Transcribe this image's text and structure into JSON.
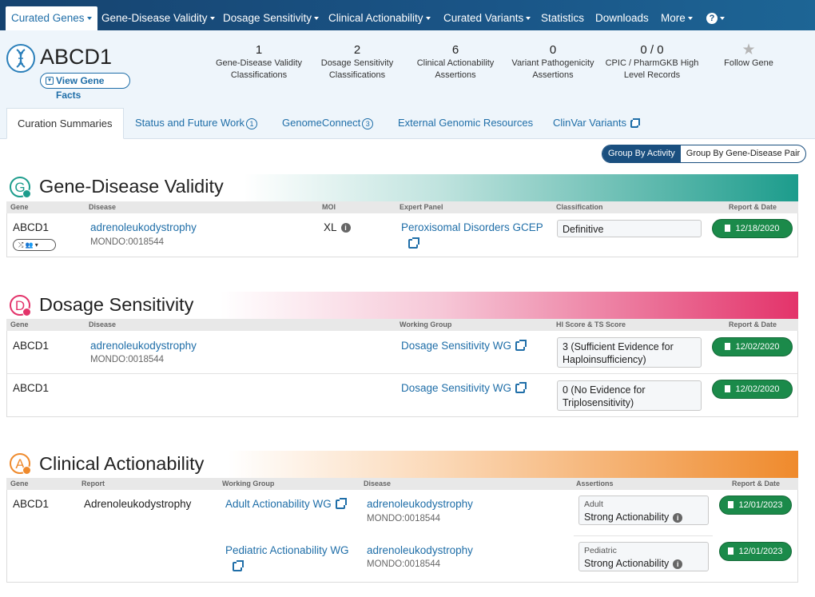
{
  "nav": {
    "items": [
      {
        "label": "Curated Genes",
        "dropdown": true
      },
      {
        "label": "Gene-Disease Validity",
        "dropdown": true
      },
      {
        "label": "Dosage Sensitivity",
        "dropdown": true
      },
      {
        "label": "Clinical Actionability",
        "dropdown": true
      },
      {
        "label": "Curated Variants",
        "dropdown": true
      },
      {
        "label": "Statistics",
        "dropdown": false
      },
      {
        "label": "Downloads",
        "dropdown": false
      },
      {
        "label": "More",
        "dropdown": true
      },
      {
        "label": "?",
        "dropdown": true
      }
    ]
  },
  "gene": {
    "symbol": "ABCD1",
    "facts_label": "View Gene Facts"
  },
  "stats": [
    {
      "value": "1",
      "label": "Gene-Disease Validity Classifications"
    },
    {
      "value": "2",
      "label": "Dosage Sensitivity Classifications"
    },
    {
      "value": "6",
      "label": "Clinical Actionability Assertions"
    },
    {
      "value": "0",
      "label": "Variant Pathogenicity Assertions"
    },
    {
      "value": "0 / 0",
      "label": "CPIC / PharmGKB High Level Records"
    },
    {
      "value": "★",
      "label": "Follow Gene"
    }
  ],
  "tabs": [
    {
      "label": "Curation Summaries",
      "count": ""
    },
    {
      "label": "Status and Future Work",
      "count": "1"
    },
    {
      "label": "GenomeConnect",
      "count": "3"
    },
    {
      "label": "External Genomic Resources",
      "count": ""
    },
    {
      "label": "ClinVar Variants",
      "count": ""
    }
  ],
  "group_toggle": {
    "by_activity": "Group By Activity",
    "by_pair": "Group By Gene-Disease Pair"
  },
  "validity": {
    "badge": "G",
    "title": "Gene-Disease Validity",
    "color": "#1c9c8c",
    "headers": {
      "gene": "Gene",
      "disease": "Disease",
      "moi": "MOI",
      "panel": "Expert Panel",
      "classification": "Classification",
      "report": "Report & Date"
    },
    "row": {
      "gene": "ABCD1",
      "disease": "adrenoleukodystrophy",
      "mondo": "MONDO:0018544",
      "moi": "XL",
      "panel": "Peroxisomal Disorders GCEP",
      "classification": "Definitive",
      "date": "12/18/2020"
    }
  },
  "dosage": {
    "badge": "D",
    "title": "Dosage Sensitivity",
    "color": "#e3336a",
    "headers": {
      "gene": "Gene",
      "disease": "Disease",
      "group": "Working Group",
      "score": "HI Score & TS Score",
      "report": "Report & Date"
    },
    "rows": [
      {
        "gene": "ABCD1",
        "disease": "adrenoleukodystrophy",
        "mondo": "MONDO:0018544",
        "group": "Dosage Sensitivity WG",
        "score": "3 (Sufficient Evidence for Haploinsufficiency)",
        "date": "12/02/2020"
      },
      {
        "gene": "ABCD1",
        "disease": "",
        "mondo": "",
        "group": "Dosage Sensitivity WG",
        "score": "0 (No Evidence for Triplosensitivity)",
        "date": "12/02/2020"
      }
    ]
  },
  "actionability": {
    "badge": "A",
    "title": "Clinical Actionability",
    "color": "#ef8a2c",
    "headers": {
      "gene": "Gene",
      "report": "Report",
      "group": "Working Group",
      "disease": "Disease",
      "assertions": "Assertions",
      "date": "Report & Date"
    },
    "gene": "ABCD1",
    "report": "Adrenoleukodystrophy",
    "rows": [
      {
        "group": "Adult Actionability WG",
        "disease": "adrenoleukodystrophy",
        "mondo": "MONDO:0018544",
        "context": "Adult",
        "assertion": "Strong Actionability",
        "date": "12/01/2023"
      },
      {
        "group": "Pediatric Actionability WG",
        "disease": "adrenoleukodystrophy",
        "mondo": "MONDO:0018544",
        "context": "Pediatric",
        "assertion": "Strong Actionability",
        "date": "12/01/2023"
      }
    ]
  }
}
